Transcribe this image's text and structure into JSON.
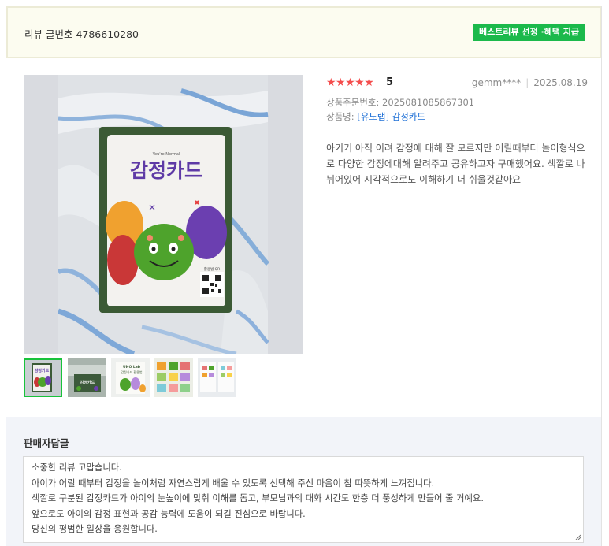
{
  "header": {
    "title": "리뷰 글번호 4786610280",
    "badge": "베스트리뷰 선정 ·혜택 지급"
  },
  "review": {
    "rating": "5",
    "author": "gemm****",
    "date": "2025.08.19",
    "order_label": "상품주문번호: 2025081085867301",
    "product_label": "상품명: ",
    "product_link": "[유노랩] 감정카드",
    "body": "아기기 아직 어려 감정에 대해 잘 모르지만 어릴때부터 놀이형식으로 다양한 감정에대해 알려주고 공유하고자 구매했어요. 색깔로 나뉘어있어 시각적으로도 이해하기 더 쉬울것같아요"
  },
  "photo": {
    "card_small": "You're Normal",
    "card_title": "감정카드",
    "qr_label": "활용법 QR"
  },
  "thumb_texts": {
    "t1": "감정카드",
    "t2": "감정카드",
    "t3_line1": "UNO Lab",
    "t3_line2": "감정카드 활용법"
  },
  "seller": {
    "title": "판매자답글",
    "lines": [
      "소중한 리뷰 고맙습니다.",
      "아이가 어릴 때부터 감정을 놀이처럼 자연스럽게 배울 수 있도록 선택해 주신 마음이 참 따뜻하게 느껴집니다.",
      "색깔로 구분된 감정카드가 아이의 눈높이에 맞춰 이해를 돕고, 부모님과의 대화 시간도 한층 더 풍성하게 만들어 줄 거예요.",
      "앞으로도 아이의 감정 표현과 공감 능력에 도움이 되길 진심으로 바랍니다.",
      "당신의 평범한 일상을 응원합니다."
    ]
  },
  "colors": {
    "badge": "#1bb94b",
    "stars": "#f44d4d",
    "link": "#1d6fd6",
    "thumb_active": "#18c23b"
  }
}
